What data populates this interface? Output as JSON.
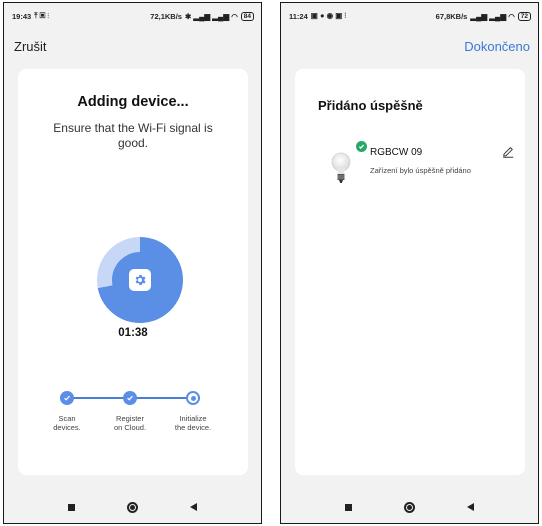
{
  "left": {
    "status": {
      "time": "19:43",
      "left_icons": "⤒ ▣ ⫶",
      "net": "72,1KB/s",
      "right_icons": "✱ ▂▄▆ ▂▄▆ ◠",
      "battery": "84"
    },
    "cancel_label": "Zrušit",
    "title": "Adding device...",
    "subtitle": "Ensure that the Wi-Fi signal is good.",
    "progress_fraction": 0.72,
    "timer": "01:38",
    "steps": [
      {
        "label": "Scan\ndevices.",
        "state": "done"
      },
      {
        "label": "Register\non Cloud.",
        "state": "done"
      },
      {
        "label": "Initialize\nthe device.",
        "state": "current"
      }
    ]
  },
  "right": {
    "status": {
      "time": "11:24",
      "left_icons": "▣ ● ◉ ▣ ⫶",
      "net": "67,8KB/s",
      "right_icons": "▂▄▆ ▂▄▆ ◠",
      "battery": "72"
    },
    "done_label": "Dokončeno",
    "title": "Přidáno úspěšně",
    "device": {
      "name": "RGBCW 09",
      "status": "Zařízení bylo úspěšně přidáno"
    }
  },
  "colors": {
    "accent": "#5b8fe6",
    "link": "#3a78d8",
    "success": "#27a86b"
  },
  "icons": [
    "gear-icon",
    "check-icon",
    "edit-icon",
    "bulb-icon",
    "recent-apps-icon",
    "home-icon",
    "back-icon"
  ]
}
